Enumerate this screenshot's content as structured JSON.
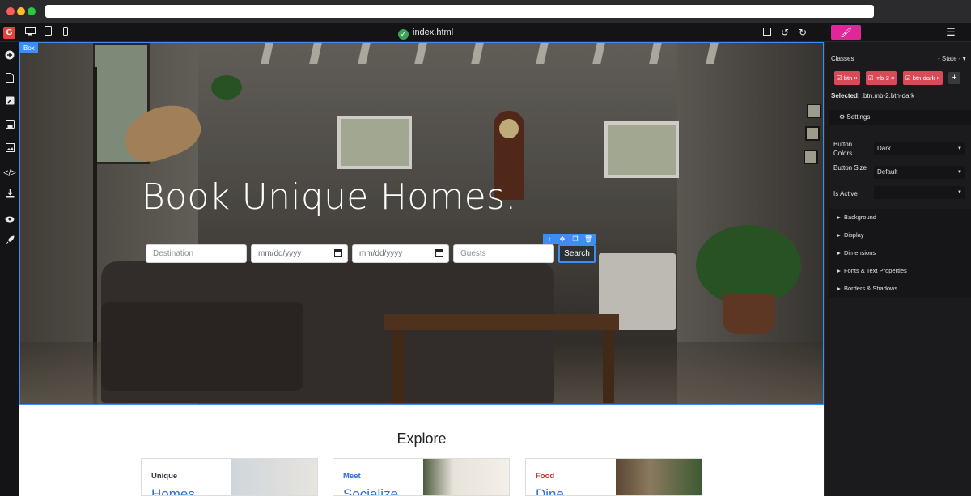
{
  "browser": {
    "traffic_lights": {
      "close": "#ff5f57",
      "minimize": "#febc2e",
      "maximize": "#28c840"
    }
  },
  "editor": {
    "file_name": "index.html",
    "accent_color": "#3f8cf2",
    "brush_tab_color": "#e0279a",
    "top_icons": [
      "desktop-icon",
      "tablet-icon",
      "mobile-icon",
      "square-icon",
      "undo-icon",
      "redo-icon",
      "menu-icon"
    ],
    "left_icons": [
      "logo-icon",
      "plus-icon",
      "page-icon",
      "pencil-icon",
      "save-icon",
      "image-icon",
      "code-icon",
      "download-icon",
      "eye-icon",
      "rocket-icon"
    ],
    "logo_letter": "G"
  },
  "canvas": {
    "selected_box_label": "Box",
    "hero": {
      "title": "Book Unique Homes.",
      "destination_placeholder": "Destination",
      "checkin_placeholder": "mm/dd/yyyy",
      "checkout_placeholder": "mm/dd/yyyy",
      "guests_placeholder": "Guests",
      "search_label": "Search"
    },
    "explore_title": "Explore",
    "cards": [
      {
        "kicker": "Unique",
        "heading": "Homes",
        "kicker_color": "#343a40"
      },
      {
        "kicker": "Meet",
        "heading": "Socialize",
        "kicker_color": "#2f6fd0"
      },
      {
        "kicker": "Food",
        "heading": "Dine",
        "kicker_color": "#c0392b"
      }
    ],
    "help_label": "?"
  },
  "panel": {
    "classes_label": "Classes",
    "state_label": "- State -",
    "class_tags": [
      "btn",
      "mb-2",
      "btn-dark"
    ],
    "selected_label": "Selected:",
    "selected_value": ".btn.mb-2.btn-dark",
    "settings_label": "Settings",
    "props": [
      {
        "label": "Button Colors",
        "value": "Dark"
      },
      {
        "label": "Button Size",
        "value": "Default"
      },
      {
        "label": "Is Active",
        "value": ""
      }
    ],
    "sections": [
      "Background",
      "Display",
      "Dimensions",
      "Fonts & Text Properties",
      "Borders & Shadows"
    ]
  }
}
